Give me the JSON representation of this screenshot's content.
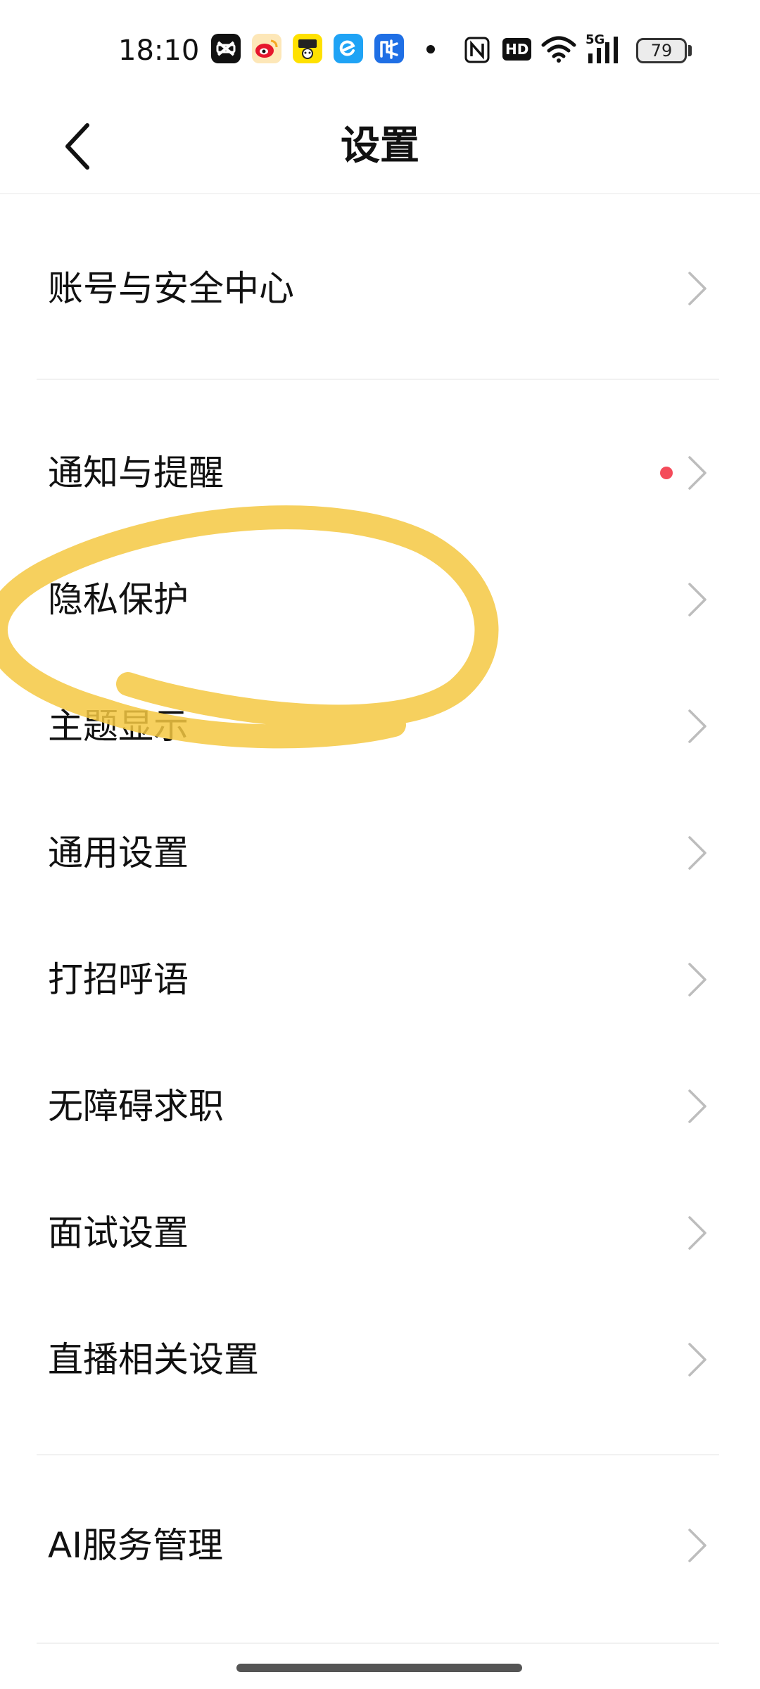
{
  "status_bar": {
    "time": "18:10",
    "apps": [
      {
        "name": "capcut",
        "glyph": "✂",
        "color": "#111111"
      },
      {
        "name": "weibo",
        "glyph": "微",
        "color": "#f6b22c"
      },
      {
        "name": "yellow-app",
        "glyph": "闲",
        "color": "#ffd400"
      },
      {
        "name": "eleme",
        "glyph": "e",
        "color": "#1fa3f5"
      },
      {
        "name": "maimai",
        "glyph": "脉",
        "color": "#1f6fe5"
      }
    ],
    "nfc_label": "N",
    "hd_label": "HD",
    "signal_label": "5G",
    "battery_level": "79"
  },
  "header": {
    "title": "设置"
  },
  "settings": {
    "account": "账号与安全中心",
    "notifications": "通知与提醒",
    "privacy": "隐私保护",
    "theme": "主题显示",
    "general": "通用设置",
    "greeting": "打招呼语",
    "accessible_jobs": "无障碍求职",
    "interview": "面试设置",
    "live": "直播相关设置",
    "ai": "AI服务管理"
  },
  "colors": {
    "highlighter": "#f5c842",
    "notification_dot": "#f44b5a"
  }
}
